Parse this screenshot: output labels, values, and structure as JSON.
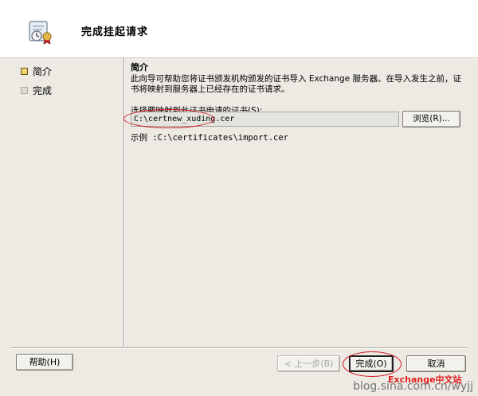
{
  "window": {
    "title": "完成挂起请求"
  },
  "nav": {
    "items": [
      {
        "label": "简介",
        "state": "active"
      },
      {
        "label": "完成",
        "state": "inactive"
      }
    ]
  },
  "content": {
    "section_title": "简介",
    "description": "此向导可帮助您将证书颁发机构颁发的证书导入 Exchange 服务器。在导入发生之前，证书将映射到服务器上已经存在的证书请求。",
    "select_label": "选择要映射到此证书申请的证书(S):",
    "path_value": "C:\\certnew_xuding.cer",
    "browse_label": "浏览(R)...",
    "example_text": "示例 :C:\\certificates\\import.cer"
  },
  "footer": {
    "help_label": "帮助(H)",
    "back_label": "< 上一步(B)",
    "finish_label": "完成(O)",
    "cancel_label": "取消"
  },
  "overlay": {
    "note": "Exchange中文站",
    "watermark": "blog.sina.com.cn/wyjj"
  },
  "colors": {
    "annotation": "#d2121e",
    "active_nav": "#f2d36b"
  }
}
